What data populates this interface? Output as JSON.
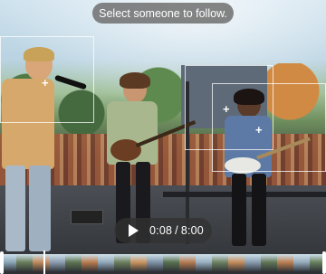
{
  "toast": {
    "text": "Select someone to follow."
  },
  "player": {
    "current_time": "0:08",
    "separator": "/",
    "duration": "8:00",
    "progress_fraction": 0.017
  },
  "icons": {
    "play": "play-icon",
    "focus_add": "plus-icon"
  },
  "timeline": {
    "thumbnail_colors": [
      "#8aa6b8",
      "#6a7e5c",
      "#c28a5c",
      "#8c9db0",
      "#5f7453",
      "#b97b4f",
      "#93a9bb",
      "#6b7f5e",
      "#c9945f",
      "#7f93a6",
      "#58704f",
      "#b57a50",
      "#9ab0c1",
      "#6d8160",
      "#c48c5b",
      "#889cb0",
      "#617556",
      "#bb7f52",
      "#95abbd",
      "#68805d"
    ]
  },
  "colors": {
    "toast_bg": "#6e6e6e",
    "control_bg": "#323232",
    "text": "#ffffff"
  }
}
